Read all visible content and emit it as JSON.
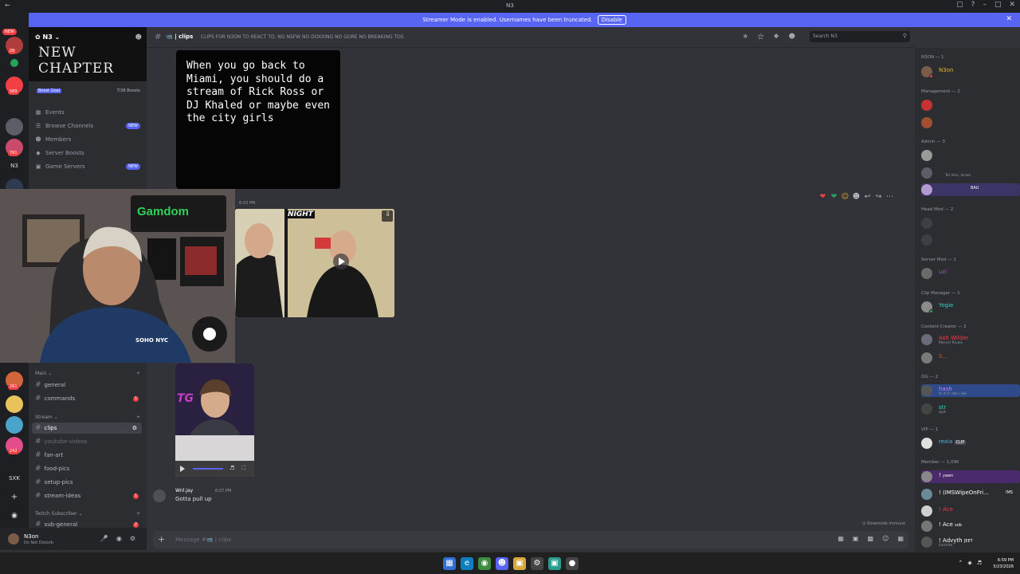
{
  "window": {
    "title": "N3"
  },
  "banner": {
    "text": "Streamer Mode is enabled. Usernames have been truncated.",
    "button": "Disable"
  },
  "rail": {
    "new_label": "NEW",
    "badges": [
      "29",
      "589",
      "761",
      "261",
      "242"
    ],
    "server_text": "N3",
    "sxk": "SXK"
  },
  "server": {
    "name": "N3",
    "banner_title": "NEW CHAPTER",
    "boost_label": "Boost Goal",
    "boost_count": "7/36 Boosts",
    "nav": [
      {
        "label": "Events",
        "new": ""
      },
      {
        "label": "Browse Channels",
        "new": "NEW"
      },
      {
        "label": "Members",
        "new": ""
      },
      {
        "label": "Server Boosts",
        "new": ""
      },
      {
        "label": "Game Servers",
        "new": "NEW"
      }
    ],
    "categories": {
      "main": "Main",
      "stream": "Stream",
      "twitch": "Twitch Subscriber"
    },
    "channels": [
      {
        "label": "general",
        "unread": ""
      },
      {
        "label": "commands",
        "unread": "1"
      },
      {
        "label": "clips",
        "unread": ""
      },
      {
        "label": "youtube-videos",
        "unread": ""
      },
      {
        "label": "fan-art",
        "unread": ""
      },
      {
        "label": "food-pics",
        "unread": ""
      },
      {
        "label": "setup-pics",
        "unread": ""
      },
      {
        "label": "stream-ideas",
        "unread": "1"
      },
      {
        "label": "sub-general",
        "unread": "2"
      }
    ]
  },
  "user": {
    "name": "N3on",
    "status": "Do Not Disturb"
  },
  "channel": {
    "name": "clips",
    "topic": "CLIPS FOR N3ON TO REACT TO. NO NSFW NO DOXXING NO GORE NO BREAKING TOS",
    "search_placeholder": "Search N3"
  },
  "webcam": {
    "sponsor": "Gamdom",
    "hoodie_text": "SOHO NYC"
  },
  "messages": {
    "text_image": "When you go back to Miami, you should do a stream of Rick Ross or DJ Khaled or maybe even the city girls",
    "time1": "6:03 PM",
    "video1_caption": "NIGHT",
    "video2_overlay": "TG",
    "author2": "Wnl.jay",
    "time2": "6:07 PM",
    "text2": "Gotta pull up"
  },
  "slowmode": "Slowmode Immune",
  "composer": {
    "placeholder": "Message #📹 | clips"
  },
  "members": {
    "roles": [
      {
        "label": "N3ON — 1"
      },
      {
        "label": "Management — 2"
      },
      {
        "label": "Admin — 3"
      },
      {
        "label": "Head Mod — 2"
      },
      {
        "label": "Server Mod — 1"
      },
      {
        "label": "Clip Manager — 1"
      },
      {
        "label": "Content Creator — 2"
      },
      {
        "label": "OG — 2"
      },
      {
        "label": "VIP — 1"
      },
      {
        "label": "Member — 1,096"
      }
    ],
    "list": [
      {
        "name": "N3on",
        "sub": ""
      },
      {
        "name": "Tel Aviv, Israel",
        "sub": ""
      },
      {
        "name": "BAU",
        "sub": ""
      },
      {
        "name": "uzi",
        "sub": ""
      },
      {
        "name": "Yogie",
        "sub": ""
      },
      {
        "name": "Ash Wilder",
        "sub": "Marvel Rivals"
      },
      {
        "name": "S...",
        "sub": ""
      },
      {
        "name": "hash",
        "sub": "fk it if i die i die"
      },
      {
        "name": "str",
        "sub": "quit"
      },
      {
        "name": "rexia",
        "sub": "CLIP"
      },
      {
        "name": "! ",
        "sub": "yawn"
      },
      {
        "name": "! (IMSWipeOnFri...",
        "sub": "IMS"
      },
      {
        "name": "! Ace",
        "sub": ""
      },
      {
        "name": "! Ace",
        "sub": "sob"
      },
      {
        "name": "! Advyth",
        "sub": "Fortnite"
      }
    ],
    "jeet": "JEET"
  },
  "taskbar": {
    "time": "6:59 PM",
    "date": "5/23/2026"
  }
}
